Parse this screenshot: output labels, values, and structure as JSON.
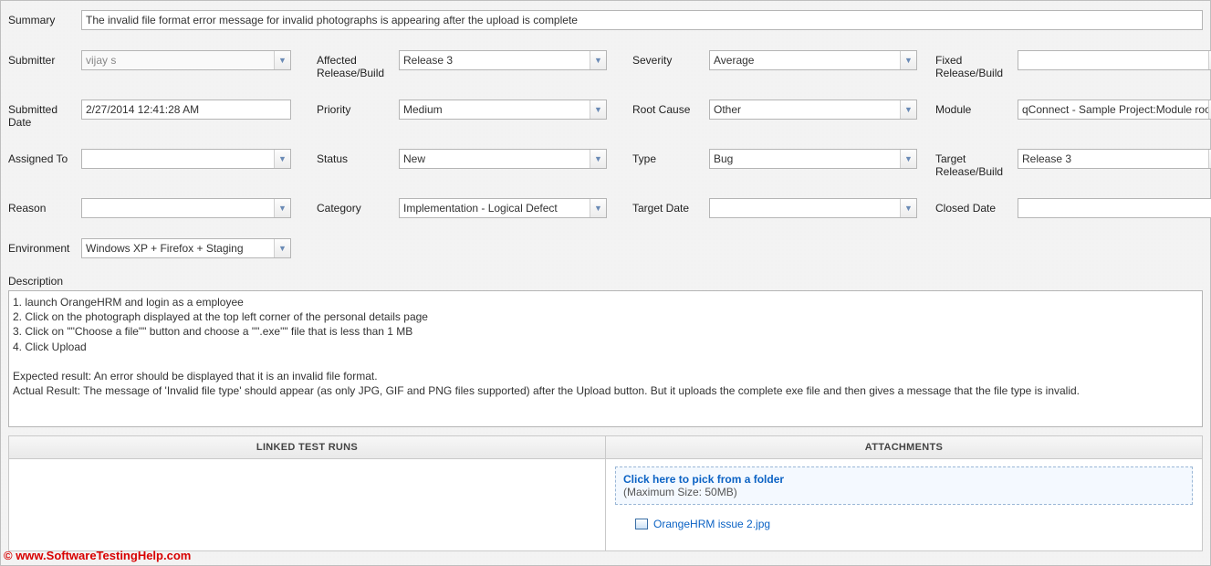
{
  "form": {
    "summary": {
      "label": "Summary",
      "value": "The invalid file format error message for invalid photographs is appearing after the upload is complete"
    },
    "submitter": {
      "label": "Submitter",
      "value": "vijay s"
    },
    "affected": {
      "label": "Affected Release/Build",
      "value": "Release 3"
    },
    "severity": {
      "label": "Severity",
      "value": "Average"
    },
    "fixed": {
      "label": "Fixed Release/Build",
      "value": ""
    },
    "submitted_date": {
      "label": "Submitted Date",
      "value": "2/27/2014 12:41:28 AM"
    },
    "priority": {
      "label": "Priority",
      "value": "Medium"
    },
    "root_cause": {
      "label": "Root Cause",
      "value": "Other"
    },
    "module": {
      "label": "Module",
      "value": "qConnect - Sample Project:Module root"
    },
    "assigned_to": {
      "label": "Assigned To",
      "value": ""
    },
    "status": {
      "label": "Status",
      "value": "New"
    },
    "type": {
      "label": "Type",
      "value": "Bug"
    },
    "target_build": {
      "label": "Target Release/Build",
      "value": "Release 3"
    },
    "reason": {
      "label": "Reason",
      "value": ""
    },
    "category": {
      "label": "Category",
      "value": "Implementation - Logical Defect"
    },
    "target_date": {
      "label": "Target Date",
      "value": ""
    },
    "closed_date": {
      "label": "Closed Date",
      "value": ""
    },
    "environment": {
      "label": "Environment",
      "value": "Windows XP + Firefox + Staging"
    },
    "description": {
      "label": "Description",
      "value": "1. launch OrangeHRM and login as a employee\n2. Click on the photograph displayed at the top left corner of the personal details page\n3. Click on \"\"Choose a file\"\" button and choose a \"\".exe\"\" file that is less than 1 MB\n4. Click Upload\n\nExpected result: An error should be displayed that it is an invalid file format.\nActual Result: The message of 'Invalid file type' should appear (as only JPG, GIF and PNG files supported) after the Upload button. But it uploads the complete exe file and then gives a message that the file type is invalid."
    }
  },
  "panels": {
    "linked": {
      "title": "LINKED TEST RUNS"
    },
    "attachments": {
      "title": "ATTACHMENTS",
      "pick_link": "Click here to pick from a folder",
      "note": "(Maximum Size: 50MB)",
      "files": [
        {
          "name": "OrangeHRM issue 2.jpg"
        }
      ]
    }
  },
  "watermark": "© www.SoftwareTestingHelp.com"
}
